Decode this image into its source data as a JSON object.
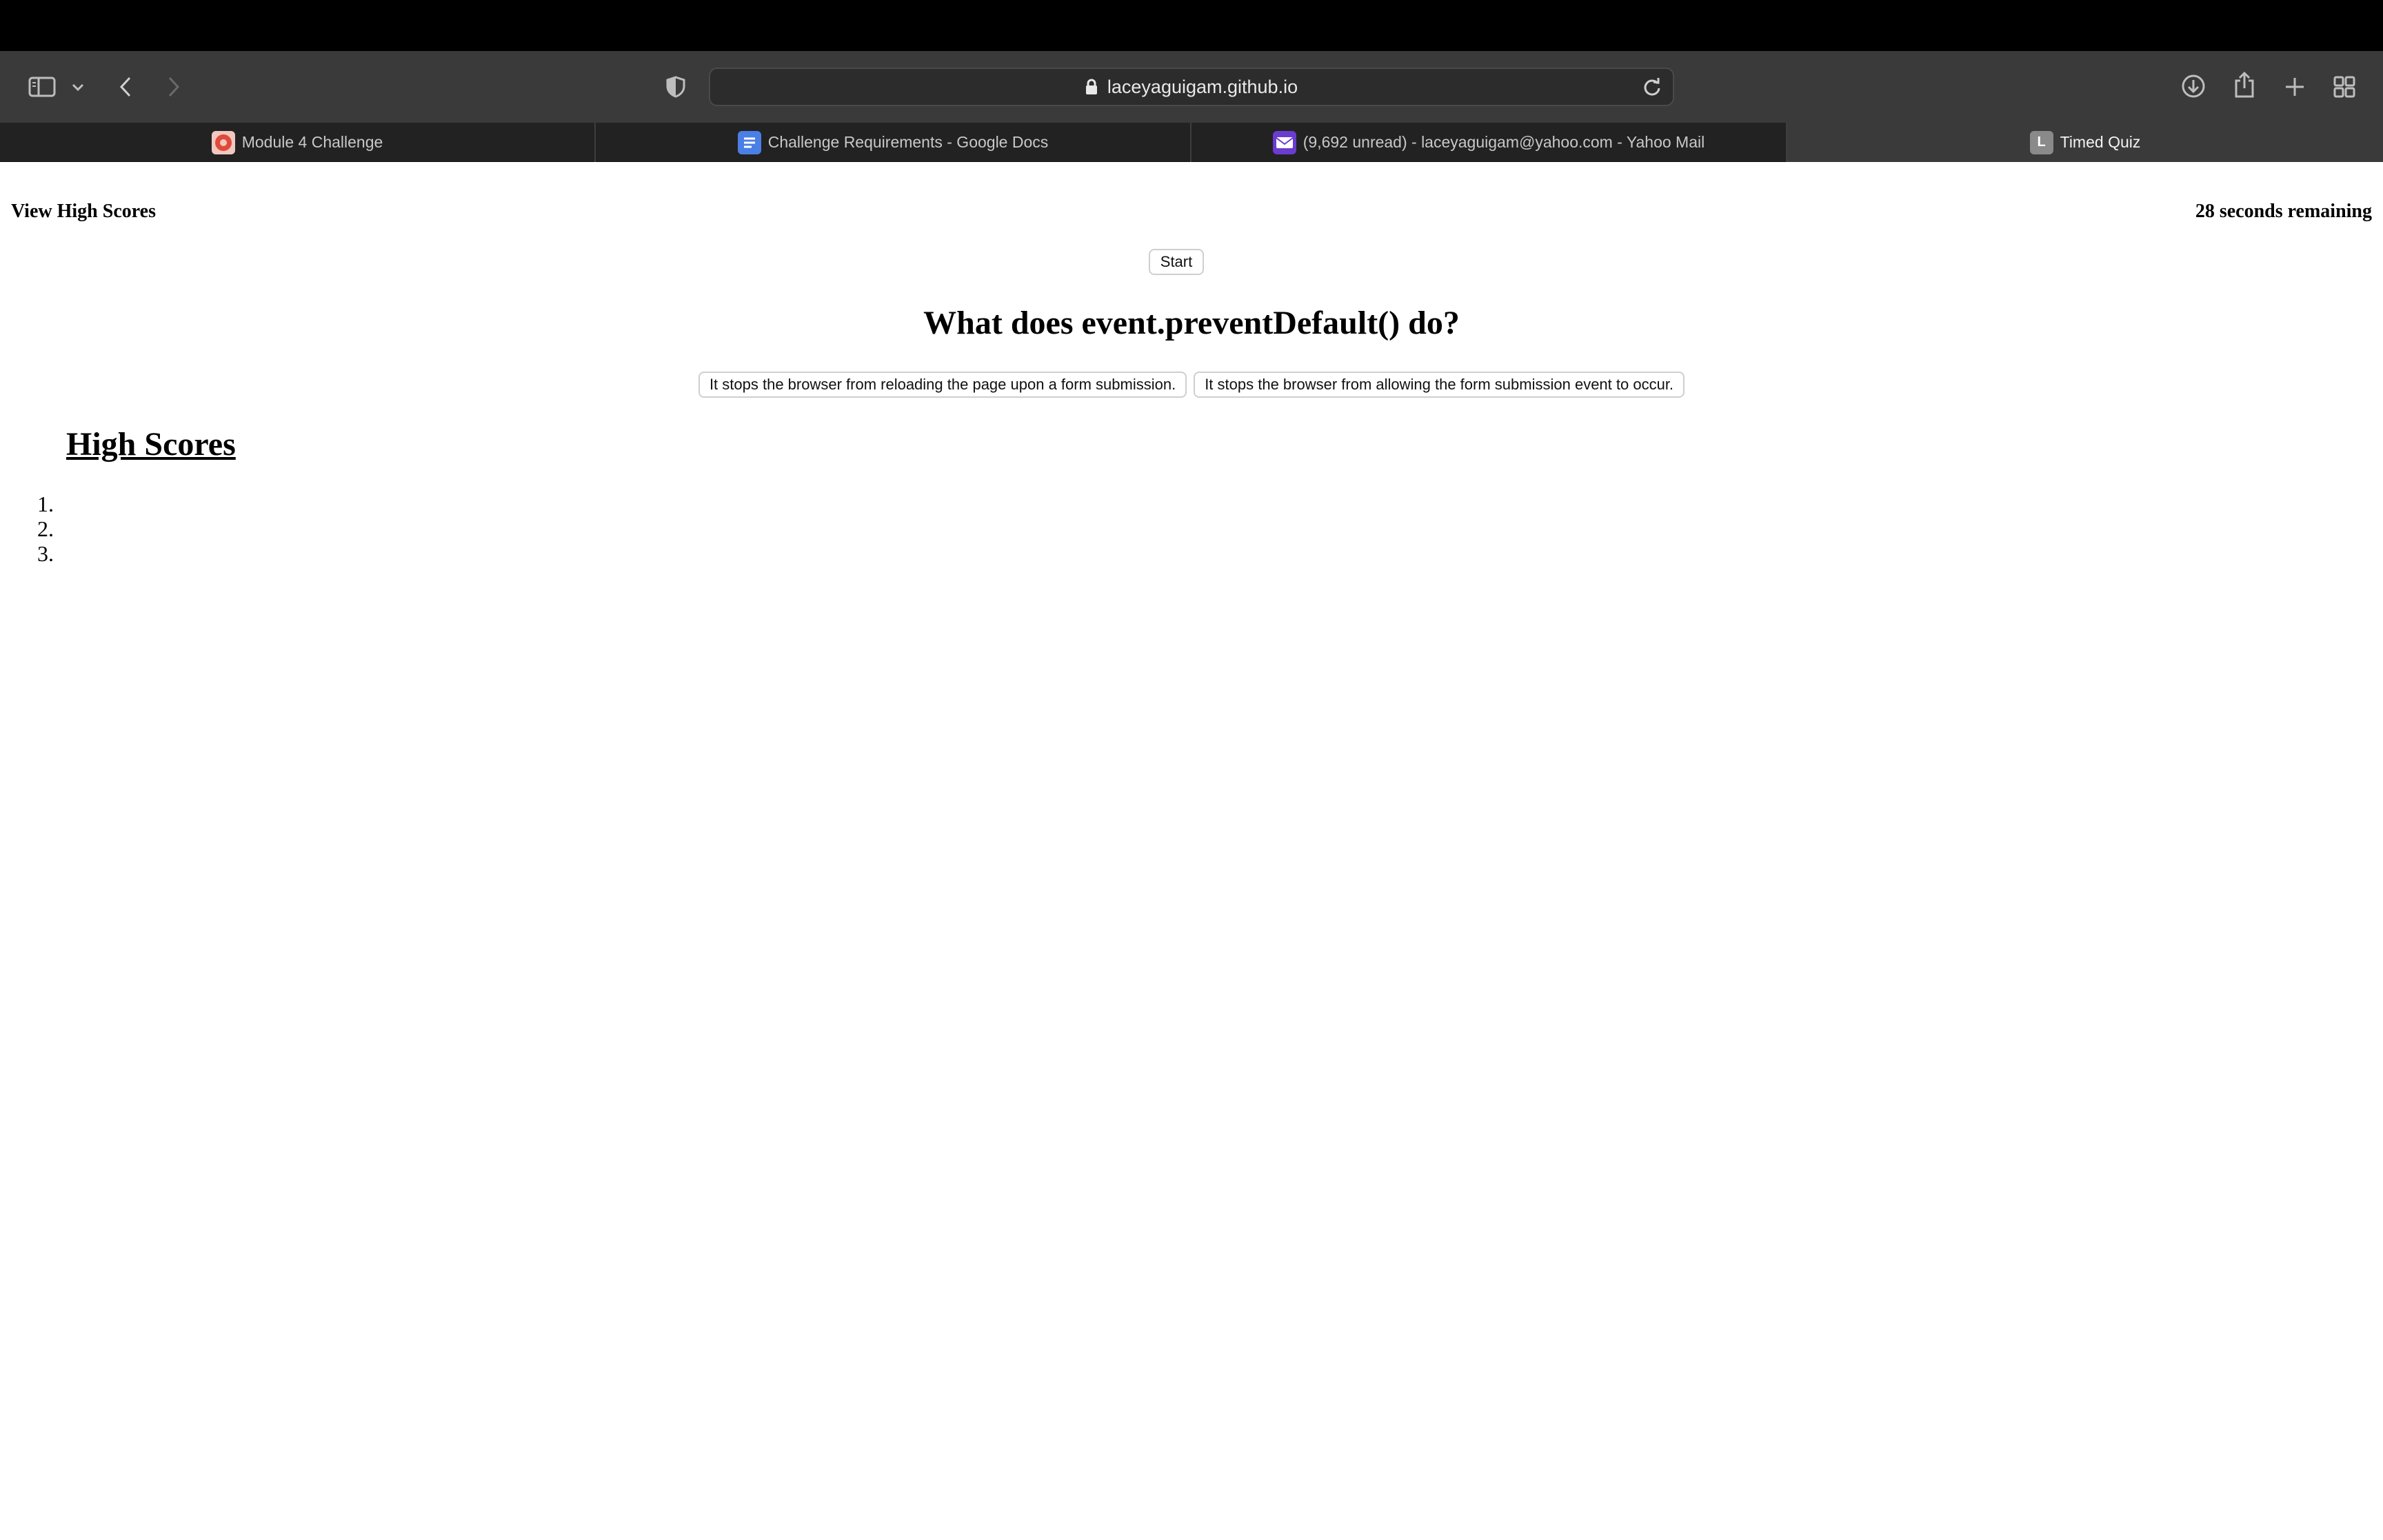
{
  "browser": {
    "url": "laceyaguigam.github.io",
    "tabs": [
      {
        "title": "Module 4 Challenge",
        "icon": "module-favicon",
        "active": false
      },
      {
        "title": "Challenge Requirements - Google Docs",
        "icon": "google-docs-favicon",
        "active": false
      },
      {
        "title": "(9,692 unread) - laceyaguigam@yahoo.com - Yahoo Mail",
        "icon": "yahoo-mail-favicon",
        "active": false
      },
      {
        "title": "Timed Quiz",
        "icon": "letter-l-favicon",
        "favicon_letter": "L",
        "active": true
      }
    ]
  },
  "quiz": {
    "view_high_scores": "View High Scores",
    "timer": "28 seconds remaining",
    "start_label": "Start",
    "question": "What does event.preventDefault() do?",
    "answers": [
      "It stops the browser from reloading the page upon a form submission.",
      "It stops the browser from allowing the form submission event to occur."
    ]
  },
  "high_scores": {
    "title": "High Scores",
    "entries": [
      {
        "number": "1.",
        "text": ""
      },
      {
        "number": "2.",
        "text": ""
      },
      {
        "number": "3.",
        "text": ""
      }
    ]
  }
}
